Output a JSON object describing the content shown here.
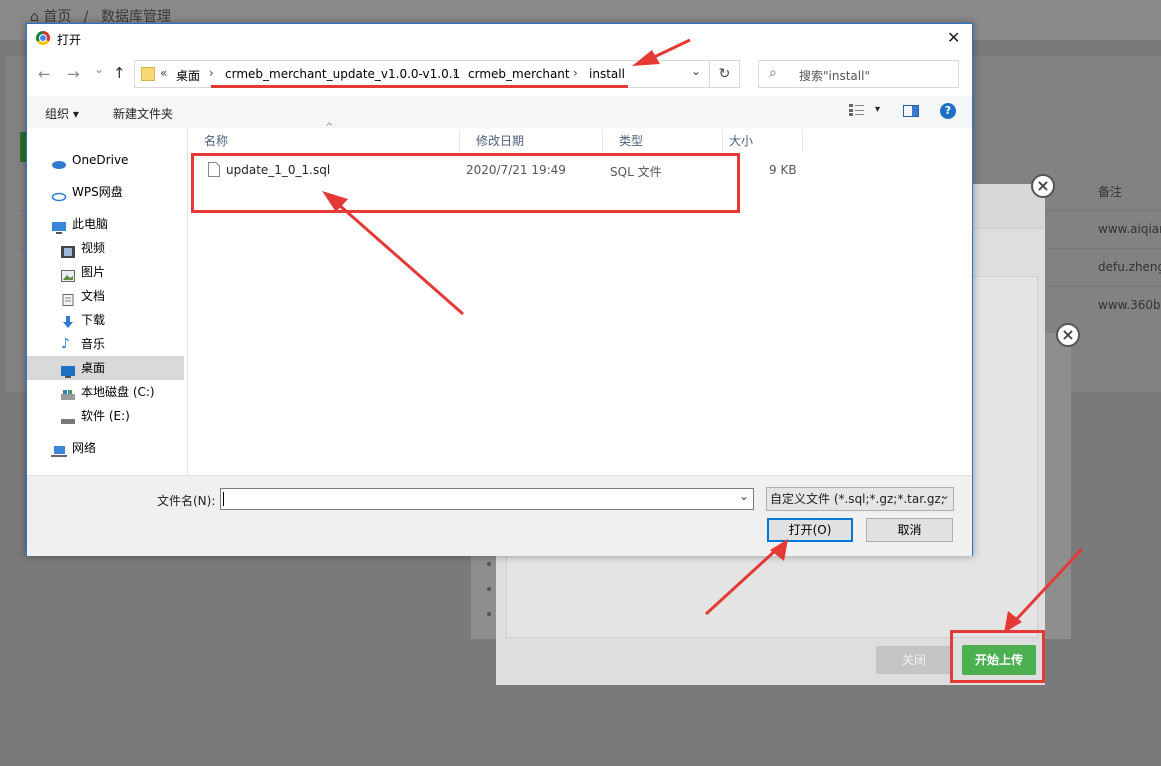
{
  "background": {
    "breadcrumb_home": "首页",
    "breadcrumb_sep": "/",
    "breadcrumb_page": "数据库管理",
    "table_header_note": "备注",
    "rows": [
      "www.aiqiar",
      "defu.zheng",
      "www.360b"
    ],
    "accent_green": "#4caf50"
  },
  "upload_modal": {
    "close_label": "关闭",
    "start_upload_label": "开始上传",
    "close_icon": "×"
  },
  "dialog": {
    "title": "打开",
    "close_icon": "✕",
    "nav": {
      "back": "←",
      "forward": "→",
      "recent": "⌄",
      "up": "↑"
    },
    "address": {
      "overflow": "«",
      "segments": [
        "桌面",
        "crmeb_merchant_update_v1.0.0-v1.0.1",
        "crmeb_merchant",
        "install"
      ],
      "separator": "›",
      "dropdown": "⌄",
      "refresh": "↻"
    },
    "search": {
      "placeholder": "搜索\"install\""
    },
    "toolbar": {
      "organize": "组织 ▾",
      "new_folder": "新建文件夹",
      "view_menu": "▾",
      "help": "?"
    },
    "sidebar": [
      {
        "label": "OneDrive",
        "icon": "cloud-icon"
      },
      {
        "label": "WPS网盘",
        "icon": "cloud-outline-icon"
      },
      {
        "label": "此电脑",
        "icon": "computer-icon"
      },
      {
        "label": "视频",
        "icon": "video-icon"
      },
      {
        "label": "图片",
        "icon": "picture-icon"
      },
      {
        "label": "文档",
        "icon": "document-icon"
      },
      {
        "label": "下载",
        "icon": "download-icon"
      },
      {
        "label": "音乐",
        "icon": "music-icon"
      },
      {
        "label": "桌面",
        "icon": "desktop-icon",
        "selected": true
      },
      {
        "label": "本地磁盘 (C:)",
        "icon": "disk-icon"
      },
      {
        "label": "软件 (E:)",
        "icon": "disk-icon"
      },
      {
        "label": "网络",
        "icon": "network-icon"
      }
    ],
    "columns": [
      "名称",
      "修改日期",
      "类型",
      "大小"
    ],
    "sort_indicator": "^",
    "files": [
      {
        "name": "update_1_0_1.sql",
        "modified": "2020/7/21 19:49",
        "type": "SQL 文件",
        "size": "9 KB"
      }
    ],
    "footer": {
      "filename_label": "文件名(N):",
      "filename_value": "",
      "filter": "自定义文件 (*.sql;*.gz;*.tar.gz;",
      "filter_dropdown": "⌄",
      "open_label": "打开(O)",
      "cancel_label": "取消"
    },
    "accent_blue": "#0078d7"
  },
  "annotations": {
    "color": "#e53935"
  }
}
